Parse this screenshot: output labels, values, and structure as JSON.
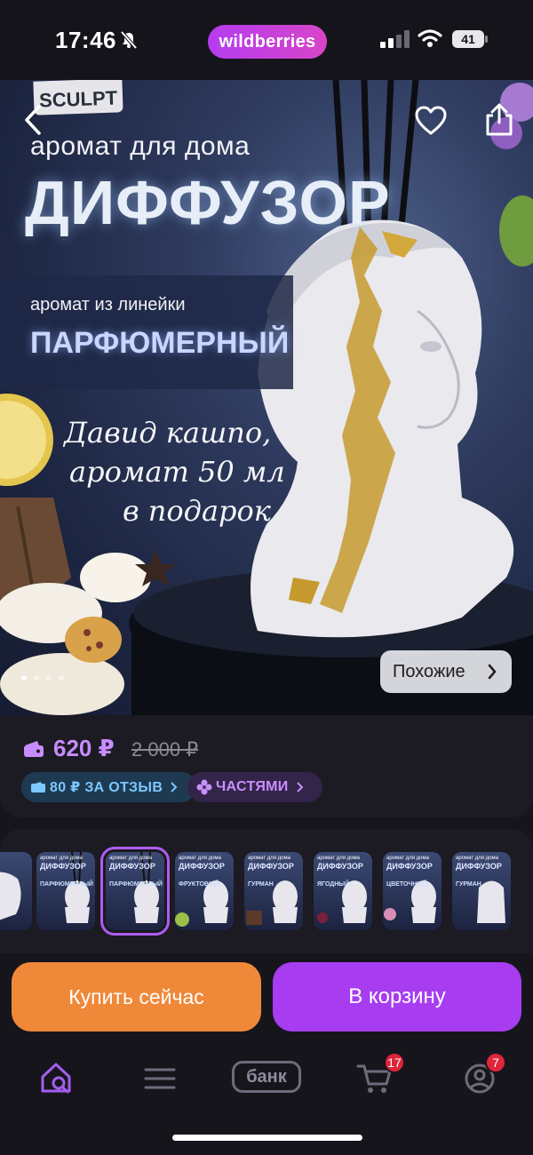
{
  "status_bar": {
    "time": "17:46",
    "brand": "wildberries",
    "battery": "41"
  },
  "hero": {
    "brand_logo": "SCULPT",
    "aroma_title": "аромат для дома",
    "product_type": "ДИФФУЗОР",
    "line_label": "аромат из линейки",
    "line_name": "ПАРФЮМЕРНЫЙ",
    "promo_lines": [
      "Давид кашпо,",
      "аромат 50 мл",
      "в подарок"
    ],
    "similar_label": "Похожие",
    "slide_count": 4,
    "active_slide": 0
  },
  "price": {
    "current": "620 ₽",
    "old": "2 000 ₽",
    "review_chip": "80 ₽ ЗА ОТЗЫВ",
    "parts_chip": "ЧАСТЯМИ"
  },
  "thumbnails": [
    {
      "title": "",
      "big": "",
      "name": ""
    },
    {
      "title": "аромат для дома",
      "big": "ДИФФУЗОР",
      "name": "ПАРФЮМЕРНЫЙ"
    },
    {
      "title": "аромат для дома",
      "big": "ДИФФУЗОР",
      "name": "ПАРФЮМЕРНЫЙ",
      "selected": true
    },
    {
      "title": "аромат для дома",
      "big": "ДИФФУЗОР",
      "name": "ФРУКТОВЫЙ"
    },
    {
      "title": "аромат для дома",
      "big": "ДИФФУЗОР",
      "name": "ГУРМАН"
    },
    {
      "title": "аромат для дома",
      "big": "ДИФФУЗОР",
      "name": "ЯГОДНЫЙ"
    },
    {
      "title": "аромат для дома",
      "big": "ДИФФУЗОР",
      "name": "ЦВЕТОЧНЫЙ"
    },
    {
      "title": "аромат для дома",
      "big": "ДИФФУЗОР",
      "name": "ГУРМАН"
    }
  ],
  "actions": {
    "buy_now": "Купить сейчас",
    "to_cart": "В корзину"
  },
  "tabbar": {
    "bank": "банк",
    "cart_badge": "17",
    "profile_badge": "7"
  },
  "colors": {
    "accent": "#a73cf0",
    "buy": "#f0883a",
    "price": "#c98cff",
    "badge": "#e0243a"
  }
}
